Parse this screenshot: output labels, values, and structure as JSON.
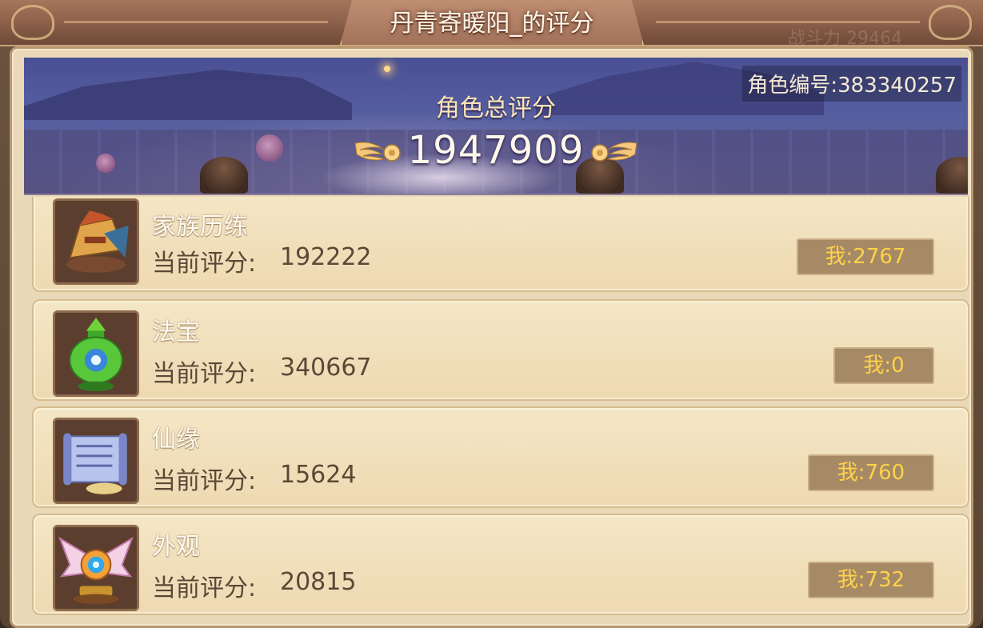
{
  "title": "丹青寄暖阳_的评分",
  "header_faded_text": "战斗力 29464",
  "banner": {
    "role_id": "角色编号:383340257",
    "total_label": "角色总评分",
    "total_value": "1947909"
  },
  "items": [
    {
      "name": "家族历练",
      "score_label": "当前评分:",
      "score": "192222",
      "mine_label": "我:",
      "mine_value": "2767",
      "icon": "family-trial-icon"
    },
    {
      "name": "法宝",
      "score_label": "当前评分:",
      "score": "340667",
      "mine_label": "我:",
      "mine_value": "0",
      "icon": "magic-treasure-icon"
    },
    {
      "name": "仙缘",
      "score_label": "当前评分:",
      "score": "15624",
      "mine_label": "我:",
      "mine_value": "760",
      "icon": "scroll-icon"
    },
    {
      "name": "外观",
      "score_label": "当前评分:",
      "score": "20815",
      "mine_label": "我:",
      "mine_value": "732",
      "icon": "winged-emblem-icon"
    }
  ],
  "colors": {
    "row_bg": "#f2e2bf",
    "mine_badge_bg": "#a68a66",
    "mine_text": "#ffd24a",
    "banner_bg": "#5a64a8"
  }
}
